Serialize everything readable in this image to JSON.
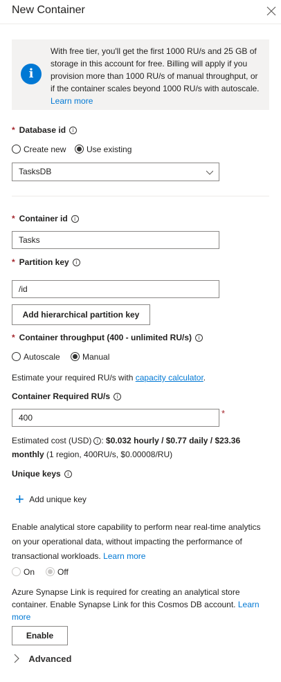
{
  "panel": {
    "title": "New Container"
  },
  "info": {
    "text": "With free tier, you'll get the first 1000 RU/s and 25 GB of storage in this account for free. Billing will apply if you provision more than 1000 RU/s of manual throughput, or if the container scales beyond 1000 RU/s with autoscale.",
    "link": "Learn more",
    "icon": "info-icon"
  },
  "database": {
    "label": "Database id",
    "options": [
      "Create new",
      "Use existing"
    ],
    "selected": "Use existing",
    "value": "TasksDB"
  },
  "container": {
    "label": "Container id",
    "value": "Tasks"
  },
  "partition": {
    "label": "Partition key",
    "value": "/id",
    "add_button": "Add hierarchical partition key"
  },
  "throughput": {
    "label": "Container throughput (400 - unlimited RU/s)",
    "options": [
      "Autoscale",
      "Manual"
    ],
    "selected": "Manual",
    "estimate_prefix": "Estimate your required RU/s with ",
    "estimate_link": "capacity calculator",
    "estimate_suffix": ".",
    "required_label": "Container Required RU/s",
    "required_value": "400",
    "cost_prefix": "Estimated cost (USD)",
    "cost_bold": "$0.032 hourly / $0.77 daily / $23.36 monthly",
    "cost_suffix": " (1 region, 400RU/s, $0.00008/RU)"
  },
  "unique_keys": {
    "label": "Unique keys",
    "add_label": "Add unique key"
  },
  "analytical": {
    "text": "Enable analytical store capability to perform near real-time analytics on your operational data, without impacting the performance of transactional workloads.",
    "link": "Learn more",
    "options": [
      "On",
      "Off"
    ],
    "selected": "Off"
  },
  "synapse": {
    "text": "Azure Synapse Link is required for creating an analytical store container. Enable Synapse Link for this Cosmos DB account.",
    "link": "Learn more",
    "button": "Enable"
  },
  "advanced": {
    "label": "Advanced"
  },
  "colors": {
    "accent": "#0078d4",
    "required": "#a4262c"
  }
}
